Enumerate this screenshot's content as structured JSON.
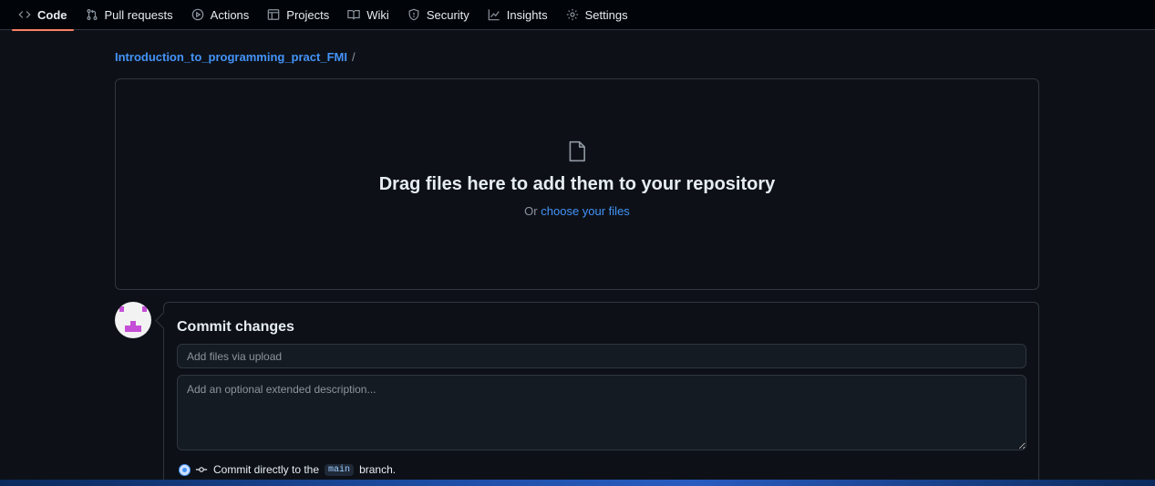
{
  "nav": {
    "tabs": [
      {
        "label": "Code",
        "icon": "code-icon",
        "active": true
      },
      {
        "label": "Pull requests",
        "icon": "pull-request-icon"
      },
      {
        "label": "Actions",
        "icon": "play-circle-icon"
      },
      {
        "label": "Projects",
        "icon": "table-icon"
      },
      {
        "label": "Wiki",
        "icon": "book-icon"
      },
      {
        "label": "Security",
        "icon": "shield-icon"
      },
      {
        "label": "Insights",
        "icon": "graph-icon"
      },
      {
        "label": "Settings",
        "icon": "gear-icon"
      }
    ]
  },
  "breadcrumb": {
    "repo": "Introduction_to_programming_pract_FMI",
    "separator": "/"
  },
  "dropzone": {
    "title": "Drag files here to add them to your repository",
    "or_text": "Or",
    "link": "choose your files"
  },
  "commit": {
    "title": "Commit changes",
    "summary_placeholder": "Add files via upload",
    "description_placeholder": "Add an optional extended description...",
    "option_prefix": "Commit directly to the",
    "branch": "main",
    "option_suffix": "branch."
  },
  "colors": {
    "accent": "#4493f8",
    "tab_underline": "#f78166",
    "background": "#0d1117",
    "border": "#30363d",
    "avatar_identicon": "#c54ed6"
  }
}
